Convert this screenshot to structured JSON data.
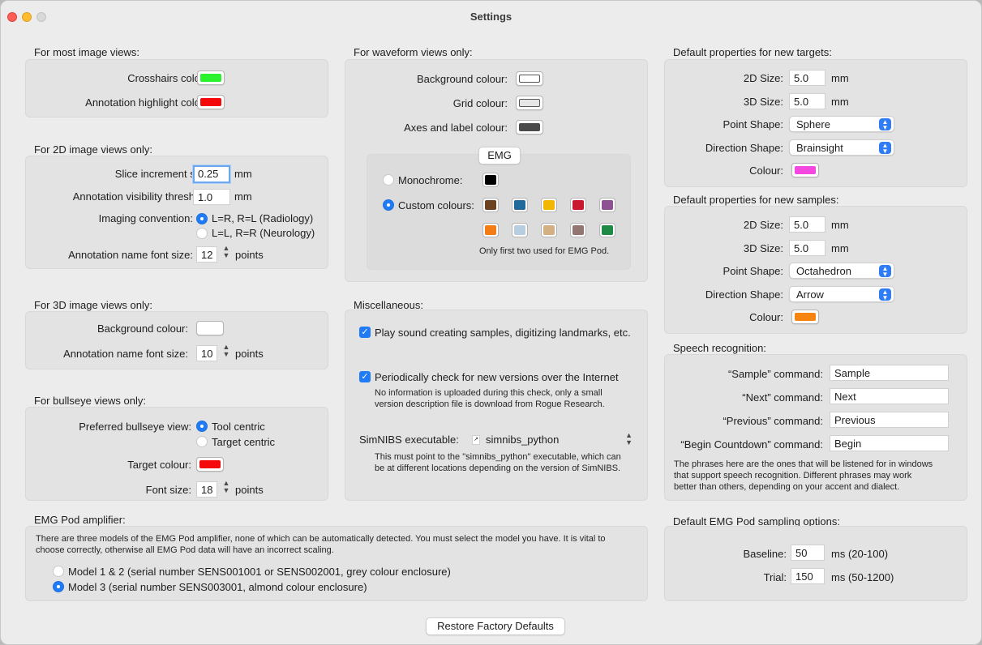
{
  "window": {
    "title": "Settings"
  },
  "most_image": {
    "header": "For most image views:",
    "crosshairs_label": "Crosshairs colour:",
    "crosshairs_color": "#29f22c",
    "annotation_highlight_label": "Annotation highlight colour:",
    "annotation_highlight_color": "#f40a0a"
  },
  "image2d": {
    "header": "For 2D image views only:",
    "slice_label": "Slice increment size:",
    "slice_value": "0.25",
    "slice_unit": "mm",
    "visibility_label": "Annotation visibility threshold:",
    "visibility_value": "1.0",
    "visibility_unit": "mm",
    "convention_label": "Imaging convention:",
    "convention_options": [
      "L=R, R=L (Radiology)",
      "L=L, R=R (Neurology)"
    ],
    "font_label": "Annotation name font size:",
    "font_value": "12",
    "font_unit": "points"
  },
  "image3d": {
    "header": "For 3D image views only:",
    "bg_label": "Background colour:",
    "bg_color": "#ffffff",
    "font_label": "Annotation name font size:",
    "font_value": "10",
    "font_unit": "points"
  },
  "bullseye": {
    "header": "For bullseye views only:",
    "pref_label": "Preferred bullseye view:",
    "pref_options": [
      "Tool centric",
      "Target centric"
    ],
    "target_color_label": "Target colour:",
    "target_color": "#f40a0a",
    "font_label": "Font size:",
    "font_value": "18",
    "font_unit": "points"
  },
  "waveform": {
    "header": "For waveform views only:",
    "bg_label": "Background colour:",
    "bg_color": "#ffffff",
    "grid_label": "Grid colour:",
    "grid_color": "#e6e6e6",
    "axes_label": "Axes and label colour:",
    "axes_color": "#4a4a4a",
    "emg_button": "EMG",
    "mono_label": "Monochrome:",
    "mono_color": "#000000",
    "custom_label": "Custom colours:",
    "custom_colors_row1": [
      "#6b4321",
      "#1f6a9a",
      "#f2b705",
      "#c8192e",
      "#8e5293"
    ],
    "custom_colors_row2": [
      "#f47c15",
      "#b7cde0",
      "#d3b083",
      "#927671",
      "#1f8a46"
    ],
    "note": "Only first two used for EMG Pod."
  },
  "misc": {
    "header": "Miscellaneous:",
    "play_sound_label": "Play sound creating samples, digitizing landmarks, etc.",
    "check_versions_label": "Periodically check for new versions over the Internet",
    "check_versions_note1": "No information is uploaded during this check, only a small",
    "check_versions_note2": "version description file is download from Rogue Research.",
    "simnibs_label": "SimNIBS executable:",
    "simnibs_value": "simnibs_python",
    "simnibs_note1": "This must point to the \"simnibs_python\" executable, which can",
    "simnibs_note2": "be at different locations depending on the version of SimNIBS."
  },
  "targets": {
    "header": "Default properties for new targets:",
    "size2d_label": "2D Size:",
    "size2d_value": "5.0",
    "size2d_unit": "mm",
    "size3d_label": "3D Size:",
    "size3d_value": "5.0",
    "size3d_unit": "mm",
    "point_label": "Point Shape:",
    "point_value": "Sphere",
    "direction_label": "Direction Shape:",
    "direction_value": "Brainsight",
    "colour_label": "Colour:",
    "colour": "#f548e0"
  },
  "samples": {
    "header": "Default properties for new samples:",
    "size2d_label": "2D Size:",
    "size2d_value": "5.0",
    "size2d_unit": "mm",
    "size3d_label": "3D Size:",
    "size3d_value": "5.0",
    "size3d_unit": "mm",
    "point_label": "Point Shape:",
    "point_value": "Octahedron",
    "direction_label": "Direction Shape:",
    "direction_value": "Arrow",
    "colour_label": "Colour:",
    "colour": "#f58410"
  },
  "speech": {
    "header": "Speech recognition:",
    "sample_label": "“Sample” command:",
    "sample_value": "Sample",
    "next_label": "“Next” command:",
    "next_value": "Next",
    "previous_label": "“Previous” command:",
    "previous_value": "Previous",
    "countdown_label": "“Begin Countdown” command:",
    "countdown_value": "Begin",
    "note1": "The phrases here are the ones that will be listened for in windows",
    "note2": "that support speech recognition. Different phrases may work",
    "note3": "better than others, depending on your accent and dialect."
  },
  "emgpod": {
    "header": "EMG Pod amplifier:",
    "note1": "There are three models of the EMG Pod amplifier, none of which can be automatically detected. You must select the model you have. It is vital to",
    "note2": "choose correctly, otherwise all EMG Pod data will have an incorrect scaling.",
    "model1": "Model 1 & 2 (serial number SENS001001 or SENS002001, grey colour enclosure)",
    "model3": "Model 3 (serial number SENS003001, almond colour enclosure)"
  },
  "sampling": {
    "header": "Default EMG Pod sampling options:",
    "baseline_label": "Baseline:",
    "baseline_value": "50",
    "baseline_unit": "ms (20-100)",
    "trial_label": "Trial:",
    "trial_value": "150",
    "trial_unit": "ms (50-1200)"
  },
  "footer": {
    "restore_button": "Restore Factory Defaults"
  }
}
